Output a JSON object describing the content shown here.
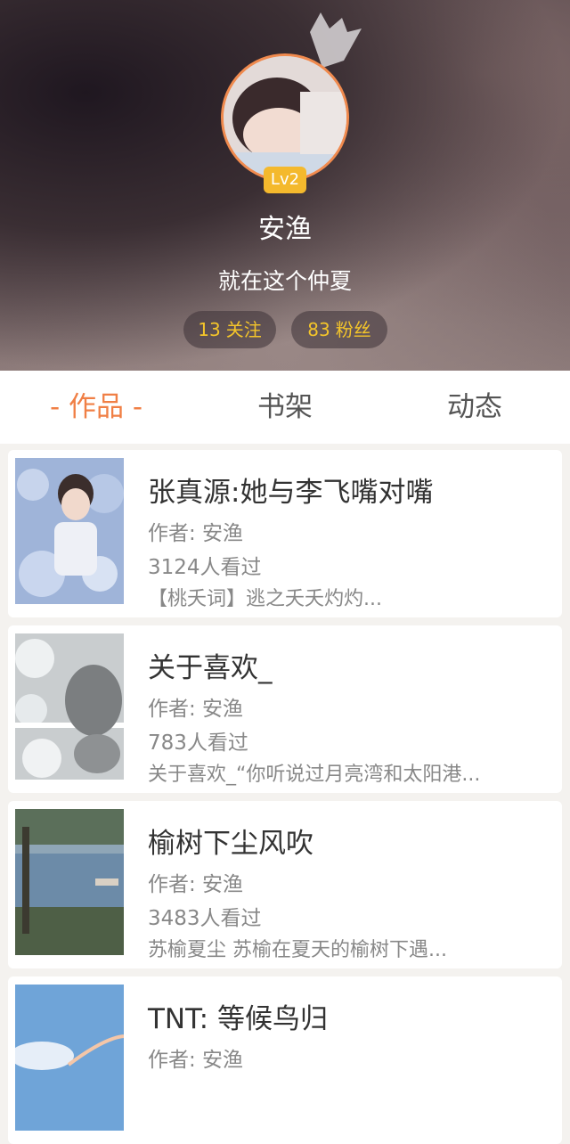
{
  "profile": {
    "level": "Lv2",
    "name": "安渔",
    "bio": "就在这个仲夏",
    "following": {
      "count": "13",
      "label": "关注"
    },
    "followers": {
      "count": "83",
      "label": "粉丝"
    }
  },
  "tabs": [
    {
      "label": "- 作品 -",
      "active": true
    },
    {
      "label": "书架",
      "active": false
    },
    {
      "label": "动态",
      "active": false
    }
  ],
  "works": [
    {
      "title": "张真源:她与李飞嘴对嘴",
      "author": "作者: 安渔",
      "views": "3124人看过",
      "desc": "【桃夭词】逃之夭夭灼灼..."
    },
    {
      "title": "关于喜欢_",
      "author": "作者: 安渔",
      "views": "783人看过",
      "desc": "关于喜欢_“你听说过月亮湾和太阳港..."
    },
    {
      "title": "榆树下尘风吹",
      "author": "作者: 安渔",
      "views": "3483人看过",
      "desc": "苏榆夏尘  苏榆在夏天的榆树下遇..."
    },
    {
      "title": "TNT: 等候鸟归",
      "author": "作者: 安渔",
      "views": "",
      "desc": ""
    }
  ],
  "colors": {
    "accent": "#f07f45",
    "level_badge": "#f4b92d",
    "stat_text": "#f4c52a",
    "avatar_ring": "#f08a4e"
  },
  "icons": {
    "crown": "crown-icon"
  }
}
